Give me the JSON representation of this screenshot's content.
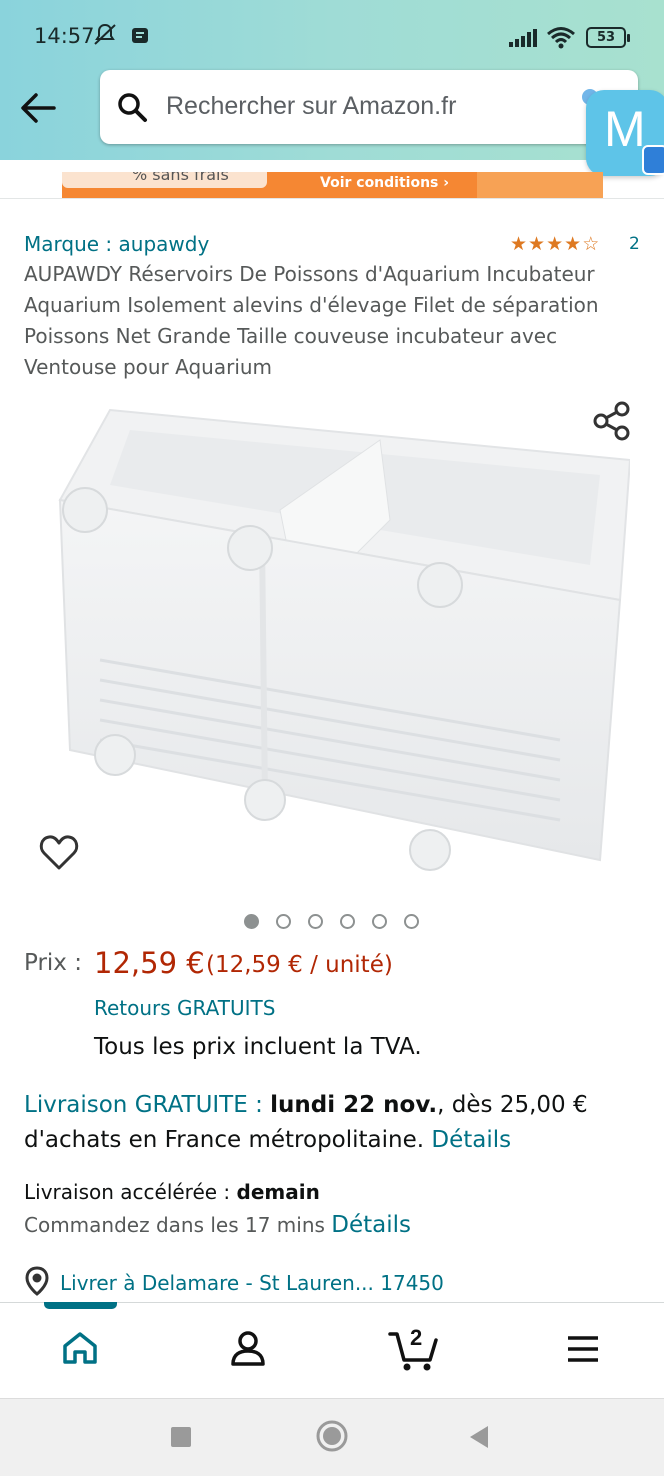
{
  "status_bar": {
    "time": "14:57",
    "battery": "53"
  },
  "search": {
    "placeholder": "Rechercher sur Amazon.fr"
  },
  "floating_bubble": {
    "letter": "M"
  },
  "banner": {
    "left_text": "% sans frais",
    "cta": "Voir conditions ›"
  },
  "product": {
    "brand": "Marque : aupawdy",
    "rating": 4.5,
    "rating_count": "2",
    "title": "AUPAWDY Réservoirs De Poissons d'Aquarium Incubateur Aquarium Isolement alevins d'élevage Filet de séparation Poissons Net Grande Taille couveuse incubateur avec Ventouse pour Aquarium",
    "image_count": 6,
    "active_image": 1
  },
  "price": {
    "label": "Prix :",
    "value": "12,59 €",
    "unit": "(12,59 € / unité)",
    "returns": "Retours GRATUITS",
    "vat": "Tous les prix incluent la TVA."
  },
  "delivery": {
    "free_label": "Livraison GRATUITE :",
    "date": "lundi 22 nov.",
    "condition": ", dès 25,00 € d'achats en France métropolitaine.",
    "details": "Détails",
    "fast_label": "Livraison accélérée :",
    "fast_when": "demain",
    "order_text": "Commandez dans les 17 mins",
    "order_details": "Détails",
    "location": "Livrer à Delamare - St Lauren... 17450"
  },
  "bottom_nav": {
    "cart_count": "2"
  },
  "colors": {
    "link": "#007185",
    "price": "#b12704",
    "star": "#de7921",
    "header_start": "#8ad3dc",
    "header_end": "#a8e1cf"
  }
}
